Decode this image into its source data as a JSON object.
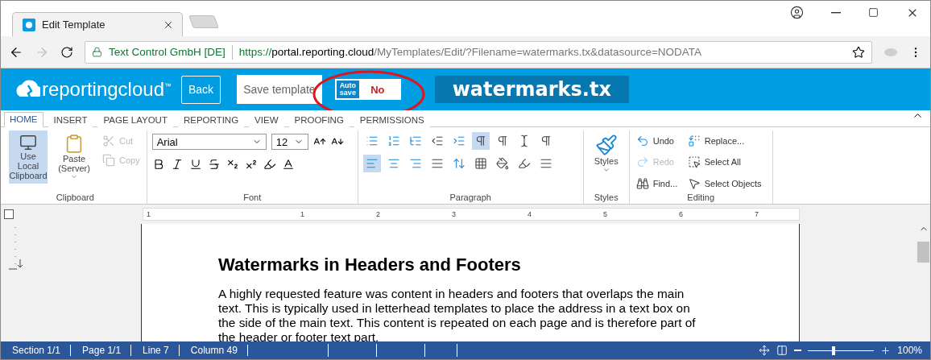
{
  "browser": {
    "tab": {
      "title": "Edit Template"
    },
    "address": {
      "site": "Text Control GmbH [DE]",
      "scheme": "https://",
      "host": "portal.reporting.cloud",
      "path": "/MyTemplates/Edit/?Filename=watermarks.tx&datasource=NODATA"
    }
  },
  "app_header": {
    "logo": "reportingcloud",
    "logo_mark": "™",
    "back": "Back",
    "save": "Save template",
    "autosave": {
      "label_1": "Auto",
      "label_2": "save",
      "value": "No",
      "on": false
    },
    "filename": "watermarks.tx"
  },
  "ribbon_tabs": [
    {
      "label": "HOME",
      "selected": true
    },
    {
      "label": "INSERT",
      "selected": false
    },
    {
      "label": "PAGE LAYOUT",
      "selected": false
    },
    {
      "label": "REPORTING",
      "selected": false
    },
    {
      "label": "VIEW",
      "selected": false
    },
    {
      "label": "PROOFING",
      "selected": false
    },
    {
      "label": "PERMISSIONS",
      "selected": false
    }
  ],
  "clipboard": {
    "title": "Clipboard",
    "local": {
      "label": "Use Local Clipboard",
      "selected": true
    },
    "paste": "Paste (Server)",
    "cut": {
      "label": "Cut",
      "disabled": true
    },
    "copy": {
      "label": "Copy",
      "disabled": true
    }
  },
  "font": {
    "title": "Font",
    "name": "Arial",
    "size": "12"
  },
  "paragraph": {
    "title": "Paragraph",
    "row_1": [
      {
        "selected": false
      },
      {
        "selected": false
      },
      {
        "selected": false
      },
      {
        "selected": false
      },
      {
        "selected": false
      },
      {
        "selected": true
      },
      {
        "selected": false
      },
      {
        "selected": false
      },
      {
        "selected": false
      }
    ],
    "row_2": [
      {
        "selected": true
      },
      {
        "selected": false
      },
      {
        "selected": false
      },
      {
        "selected": false
      },
      {
        "selected": false
      },
      {
        "selected": false
      },
      {
        "selected": false
      },
      {
        "selected": false
      },
      {
        "selected": false
      }
    ]
  },
  "styles": {
    "title": "Styles",
    "label": "Styles"
  },
  "editing": {
    "title": "Editing",
    "items": [
      {
        "label": "Undo",
        "disabled": false
      },
      {
        "label": "Replace...",
        "disabled": false
      },
      {
        "label": "Redo",
        "disabled": true
      },
      {
        "label": "Select All",
        "disabled": false
      },
      {
        "label": "Find...",
        "disabled": false
      },
      {
        "label": "Select Objects",
        "disabled": false
      }
    ]
  },
  "ruler": {
    "labels": [
      "1",
      "1",
      "2",
      "3",
      "4",
      "5",
      "6",
      "7"
    ]
  },
  "document": {
    "heading": "Watermarks in Headers and Footers",
    "lines": [
      "A highly requested feature was content in headers and footers that overlaps the main",
      "text. This is typically used in letterhead templates to place the address in a text box on",
      "the side of the main text. This content is repeated on each page and is therefore part of",
      "the header or footer text part."
    ]
  },
  "status_bar": {
    "items": [
      "Section 1/1",
      "Page 1/1",
      "Line 7",
      "Column 49"
    ],
    "zoom": {
      "level": 0.38,
      "reading": "100%"
    }
  }
}
